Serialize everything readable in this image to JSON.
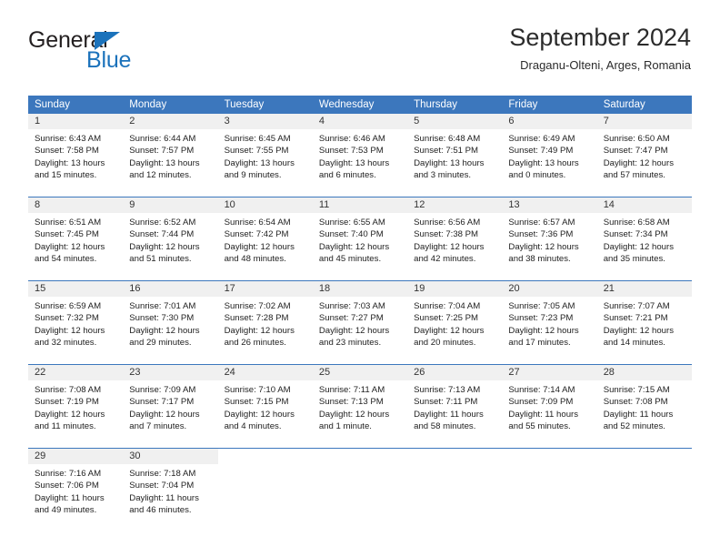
{
  "logo": {
    "word1": "General",
    "word2": "Blue",
    "triangle_color": "#1b72bb",
    "word1_color": "#231f20",
    "word2_color": "#1b72bb"
  },
  "header": {
    "title": "September 2024",
    "subtitle": "Draganu-Olteni, Arges, Romania"
  },
  "theme": {
    "header_blue": "#3c77bd",
    "daynum_band": "#f0f0f0",
    "cell_bg": "#ffffff",
    "text": "#222222"
  },
  "weekdays": [
    "Sunday",
    "Monday",
    "Tuesday",
    "Wednesday",
    "Thursday",
    "Friday",
    "Saturday"
  ],
  "weeks": [
    [
      {
        "day": "1",
        "sunrise": "Sunrise: 6:43 AM",
        "sunset": "Sunset: 7:58 PM",
        "daylight1": "Daylight: 13 hours",
        "daylight2": "and 15 minutes."
      },
      {
        "day": "2",
        "sunrise": "Sunrise: 6:44 AM",
        "sunset": "Sunset: 7:57 PM",
        "daylight1": "Daylight: 13 hours",
        "daylight2": "and 12 minutes."
      },
      {
        "day": "3",
        "sunrise": "Sunrise: 6:45 AM",
        "sunset": "Sunset: 7:55 PM",
        "daylight1": "Daylight: 13 hours",
        "daylight2": "and 9 minutes."
      },
      {
        "day": "4",
        "sunrise": "Sunrise: 6:46 AM",
        "sunset": "Sunset: 7:53 PM",
        "daylight1": "Daylight: 13 hours",
        "daylight2": "and 6 minutes."
      },
      {
        "day": "5",
        "sunrise": "Sunrise: 6:48 AM",
        "sunset": "Sunset: 7:51 PM",
        "daylight1": "Daylight: 13 hours",
        "daylight2": "and 3 minutes."
      },
      {
        "day": "6",
        "sunrise": "Sunrise: 6:49 AM",
        "sunset": "Sunset: 7:49 PM",
        "daylight1": "Daylight: 13 hours",
        "daylight2": "and 0 minutes."
      },
      {
        "day": "7",
        "sunrise": "Sunrise: 6:50 AM",
        "sunset": "Sunset: 7:47 PM",
        "daylight1": "Daylight: 12 hours",
        "daylight2": "and 57 minutes."
      }
    ],
    [
      {
        "day": "8",
        "sunrise": "Sunrise: 6:51 AM",
        "sunset": "Sunset: 7:45 PM",
        "daylight1": "Daylight: 12 hours",
        "daylight2": "and 54 minutes."
      },
      {
        "day": "9",
        "sunrise": "Sunrise: 6:52 AM",
        "sunset": "Sunset: 7:44 PM",
        "daylight1": "Daylight: 12 hours",
        "daylight2": "and 51 minutes."
      },
      {
        "day": "10",
        "sunrise": "Sunrise: 6:54 AM",
        "sunset": "Sunset: 7:42 PM",
        "daylight1": "Daylight: 12 hours",
        "daylight2": "and 48 minutes."
      },
      {
        "day": "11",
        "sunrise": "Sunrise: 6:55 AM",
        "sunset": "Sunset: 7:40 PM",
        "daylight1": "Daylight: 12 hours",
        "daylight2": "and 45 minutes."
      },
      {
        "day": "12",
        "sunrise": "Sunrise: 6:56 AM",
        "sunset": "Sunset: 7:38 PM",
        "daylight1": "Daylight: 12 hours",
        "daylight2": "and 42 minutes."
      },
      {
        "day": "13",
        "sunrise": "Sunrise: 6:57 AM",
        "sunset": "Sunset: 7:36 PM",
        "daylight1": "Daylight: 12 hours",
        "daylight2": "and 38 minutes."
      },
      {
        "day": "14",
        "sunrise": "Sunrise: 6:58 AM",
        "sunset": "Sunset: 7:34 PM",
        "daylight1": "Daylight: 12 hours",
        "daylight2": "and 35 minutes."
      }
    ],
    [
      {
        "day": "15",
        "sunrise": "Sunrise: 6:59 AM",
        "sunset": "Sunset: 7:32 PM",
        "daylight1": "Daylight: 12 hours",
        "daylight2": "and 32 minutes."
      },
      {
        "day": "16",
        "sunrise": "Sunrise: 7:01 AM",
        "sunset": "Sunset: 7:30 PM",
        "daylight1": "Daylight: 12 hours",
        "daylight2": "and 29 minutes."
      },
      {
        "day": "17",
        "sunrise": "Sunrise: 7:02 AM",
        "sunset": "Sunset: 7:28 PM",
        "daylight1": "Daylight: 12 hours",
        "daylight2": "and 26 minutes."
      },
      {
        "day": "18",
        "sunrise": "Sunrise: 7:03 AM",
        "sunset": "Sunset: 7:27 PM",
        "daylight1": "Daylight: 12 hours",
        "daylight2": "and 23 minutes."
      },
      {
        "day": "19",
        "sunrise": "Sunrise: 7:04 AM",
        "sunset": "Sunset: 7:25 PM",
        "daylight1": "Daylight: 12 hours",
        "daylight2": "and 20 minutes."
      },
      {
        "day": "20",
        "sunrise": "Sunrise: 7:05 AM",
        "sunset": "Sunset: 7:23 PM",
        "daylight1": "Daylight: 12 hours",
        "daylight2": "and 17 minutes."
      },
      {
        "day": "21",
        "sunrise": "Sunrise: 7:07 AM",
        "sunset": "Sunset: 7:21 PM",
        "daylight1": "Daylight: 12 hours",
        "daylight2": "and 14 minutes."
      }
    ],
    [
      {
        "day": "22",
        "sunrise": "Sunrise: 7:08 AM",
        "sunset": "Sunset: 7:19 PM",
        "daylight1": "Daylight: 12 hours",
        "daylight2": "and 11 minutes."
      },
      {
        "day": "23",
        "sunrise": "Sunrise: 7:09 AM",
        "sunset": "Sunset: 7:17 PM",
        "daylight1": "Daylight: 12 hours",
        "daylight2": "and 7 minutes."
      },
      {
        "day": "24",
        "sunrise": "Sunrise: 7:10 AM",
        "sunset": "Sunset: 7:15 PM",
        "daylight1": "Daylight: 12 hours",
        "daylight2": "and 4 minutes."
      },
      {
        "day": "25",
        "sunrise": "Sunrise: 7:11 AM",
        "sunset": "Sunset: 7:13 PM",
        "daylight1": "Daylight: 12 hours",
        "daylight2": "and 1 minute."
      },
      {
        "day": "26",
        "sunrise": "Sunrise: 7:13 AM",
        "sunset": "Sunset: 7:11 PM",
        "daylight1": "Daylight: 11 hours",
        "daylight2": "and 58 minutes."
      },
      {
        "day": "27",
        "sunrise": "Sunrise: 7:14 AM",
        "sunset": "Sunset: 7:09 PM",
        "daylight1": "Daylight: 11 hours",
        "daylight2": "and 55 minutes."
      },
      {
        "day": "28",
        "sunrise": "Sunrise: 7:15 AM",
        "sunset": "Sunset: 7:08 PM",
        "daylight1": "Daylight: 11 hours",
        "daylight2": "and 52 minutes."
      }
    ],
    [
      {
        "day": "29",
        "sunrise": "Sunrise: 7:16 AM",
        "sunset": "Sunset: 7:06 PM",
        "daylight1": "Daylight: 11 hours",
        "daylight2": "and 49 minutes."
      },
      {
        "day": "30",
        "sunrise": "Sunrise: 7:18 AM",
        "sunset": "Sunset: 7:04 PM",
        "daylight1": "Daylight: 11 hours",
        "daylight2": "and 46 minutes."
      },
      {
        "day": "",
        "sunrise": "",
        "sunset": "",
        "daylight1": "",
        "daylight2": ""
      },
      {
        "day": "",
        "sunrise": "",
        "sunset": "",
        "daylight1": "",
        "daylight2": ""
      },
      {
        "day": "",
        "sunrise": "",
        "sunset": "",
        "daylight1": "",
        "daylight2": ""
      },
      {
        "day": "",
        "sunrise": "",
        "sunset": "",
        "daylight1": "",
        "daylight2": ""
      },
      {
        "day": "",
        "sunrise": "",
        "sunset": "",
        "daylight1": "",
        "daylight2": ""
      }
    ]
  ]
}
